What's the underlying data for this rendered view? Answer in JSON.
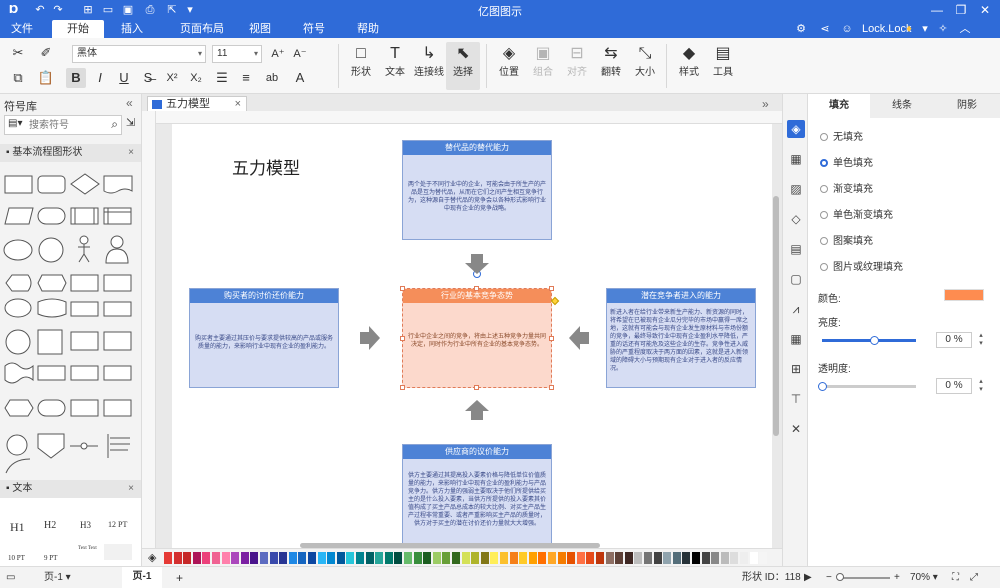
{
  "app": {
    "title": "亿图图示",
    "quick_icons": [
      "logo-icon",
      "undo-icon",
      "redo-icon",
      "new-icon",
      "open-icon",
      "save-icon",
      "print-icon",
      "export-icon",
      "dropdown-icon"
    ]
  },
  "menu": {
    "tabs": [
      {
        "label": "文件",
        "active": false
      },
      {
        "label": "开始",
        "active": true
      },
      {
        "label": "插入",
        "active": false
      },
      {
        "label": "页面布局",
        "active": false
      },
      {
        "label": "视图",
        "active": false
      },
      {
        "label": "符号",
        "active": false
      },
      {
        "label": "帮助",
        "active": false
      }
    ],
    "user": "Lock.Lock"
  },
  "ribbon": {
    "font_family": "黑体",
    "font_size": "11",
    "big_buttons": [
      {
        "label": "形状",
        "icon": "□",
        "disabled": false,
        "selected": false
      },
      {
        "label": "文本",
        "icon": "T",
        "disabled": false,
        "selected": false
      },
      {
        "label": "连接线",
        "icon": "↳",
        "disabled": false,
        "selected": false
      },
      {
        "label": "选择",
        "icon": "⬉",
        "disabled": false,
        "selected": true
      },
      {
        "label": "位置",
        "icon": "◈",
        "disabled": false,
        "selected": false
      },
      {
        "label": "组合",
        "icon": "▣",
        "disabled": true,
        "selected": false
      },
      {
        "label": "对齐",
        "icon": "⊟",
        "disabled": true,
        "selected": false
      },
      {
        "label": "翻转",
        "icon": "⇆",
        "disabled": false,
        "selected": false
      },
      {
        "label": "大小",
        "icon": "⤡",
        "disabled": false,
        "selected": false
      },
      {
        "label": "样式",
        "icon": "◆",
        "disabled": false,
        "selected": false
      },
      {
        "label": "工具",
        "icon": "▤",
        "disabled": false,
        "selected": false
      }
    ]
  },
  "left_panel": {
    "title": "符号库",
    "search_placeholder": "搜索符号",
    "section_basic": "基本流程图形状",
    "section_text": "文本",
    "text_styles": [
      "H1",
      "H2",
      "H3",
      "12 PT",
      "10 PT",
      "9 PT",
      "Text Text",
      ""
    ]
  },
  "document": {
    "tab_name": "五力模型",
    "diagram_title": "五力模型",
    "cards": {
      "top": {
        "title": "替代品的替代能力",
        "body": "两个处于不同行业中的企业，可能会由于所生产的产品是互为替代品，从而在它们之间产生相互竞争行为，这种源自于替代品的竞争会以各种形式影响行业中现有企业的竞争战略。"
      },
      "left": {
        "title": "购买者的讨价还价能力",
        "body": "购买者主要通过其压价与要求提供较高的产品或服务质量的能力，来影响行业中现有企业的盈利能力。"
      },
      "center": {
        "title": "行业的基本竞争态势",
        "body": "行业中企业之间的竞争，将由上述五种竞争力量共同决定，同时作为行业中所有企业的基本竞争态势。"
      },
      "right": {
        "title": "潜在竞争者进入的能力",
        "body": "新进入者在给行业带来新生产能力、新资源的同时，将希望在已被现有企业瓜分完毕的市场中赢得一席之地，这就有可能会与现有企业发生原材料与市场份额的竞争，最终导致行业中现有企业盈利水平降低，严重的话还有可能危及这些企业的生存。竞争性进入威胁的严重程度取决于两方面的因素，这就是进入新领域的障碍大小与预期现有企业对于进入者的反应情况。"
      },
      "bottom": {
        "title": "供应商的议价能力",
        "body": "供方主要通过其提高投入要素价格与降低单位价值质量的能力，来影响行业中现有企业的盈利能力与产品竞争力。供方力量的强弱主要取决于他们所提供给买主的是什么投入要素，当供方所提供的投入要素其价值构成了买主产品总成本的较大比例、对买主产品生产过程非常重要、或者严重影响买主产品的质量时，供方对于买主的潜在讨价还价力量就大大增强。"
      }
    }
  },
  "right_panel": {
    "tabs": [
      "填充",
      "线条",
      "阴影"
    ],
    "fill_options": [
      {
        "label": "无填充",
        "selected": false
      },
      {
        "label": "单色填充",
        "selected": true
      },
      {
        "label": "渐变填充",
        "selected": false
      },
      {
        "label": "单色渐变填充",
        "selected": false
      },
      {
        "label": "图案填充",
        "selected": false
      },
      {
        "label": "图片或纹理填充",
        "selected": false
      }
    ],
    "color_label": "颜色:",
    "color_value": "#fe8c50",
    "brightness_label": "亮度:",
    "brightness_value": "0 %",
    "brightness_level": 0.55,
    "transparency_label": "透明度:",
    "transparency_value": "0 %",
    "transparency_level": 0.0
  },
  "status": {
    "page_dropdown": "页-1",
    "active_page": "页-1",
    "add_page": "+",
    "shape_id": "形状 ID：118",
    "zoom": "70%"
  },
  "colors": {
    "accent": "#2f6bd8",
    "card_header": "#4d82d6",
    "card_body": "#d6ddf3",
    "center_header": "#f58e5a",
    "center_body": "#fcd9cc"
  },
  "palette": [
    "#e53935",
    "#d32f2f",
    "#c62828",
    "#ad1457",
    "#ec407a",
    "#f06292",
    "#ff80ab",
    "#ab47bc",
    "#7b1fa2",
    "#4a148c",
    "#5c6bc0",
    "#3949ab",
    "#283593",
    "#1e88e5",
    "#1565c0",
    "#0d47a1",
    "#29b6f6",
    "#0288d1",
    "#01579b",
    "#26c6da",
    "#00838f",
    "#006064",
    "#26a69a",
    "#00796b",
    "#004d40",
    "#66bb6a",
    "#388e3c",
    "#1b5e20",
    "#9ccc65",
    "#689f38",
    "#33691e",
    "#d4e157",
    "#afb42b",
    "#827717",
    "#ffee58",
    "#fbc02d",
    "#f57f17",
    "#ffca28",
    "#ffa000",
    "#ff6f00",
    "#ffa726",
    "#f57c00",
    "#e65100",
    "#ff7043",
    "#e64a19",
    "#bf360c",
    "#8d6e63",
    "#5d4037",
    "#3e2723",
    "#bdbdbd",
    "#757575",
    "#424242",
    "#90a4ae",
    "#546e7a",
    "#263238",
    "#000000",
    "#444444",
    "#888888",
    "#bbbbbb",
    "#dddddd",
    "#eeeeee",
    "#ffffff",
    "#f5f5f5"
  ]
}
